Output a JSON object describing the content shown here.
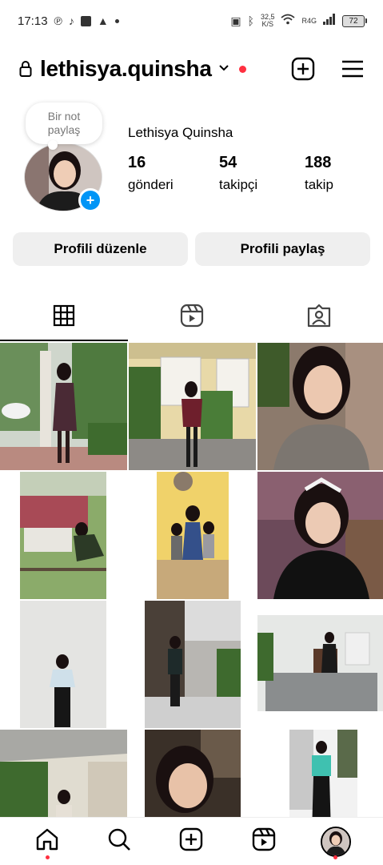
{
  "status_bar": {
    "time": "17:13",
    "speed_value": "32,5",
    "speed_unit": "K/S",
    "network": "R4G",
    "battery": "72"
  },
  "header": {
    "username": "lethisya.quinsha"
  },
  "profile": {
    "note_text": "Bir not paylaş",
    "full_name": "Lethisya Quinsha",
    "stats": {
      "posts_count": "16",
      "posts_label": "gönderi",
      "followers_count": "54",
      "followers_label": "takipçi",
      "following_count": "188",
      "following_label": "takip"
    }
  },
  "actions": {
    "edit_profile": "Profili düzenle",
    "share_profile": "Profili paylaş"
  },
  "tabs": [
    {
      "icon": "grid-icon",
      "active": true
    },
    {
      "icon": "reels-icon",
      "active": false
    },
    {
      "icon": "tagged-icon",
      "active": false
    }
  ],
  "bottom_nav": [
    {
      "icon": "home-icon",
      "notification_dot": true
    },
    {
      "icon": "search-icon",
      "notification_dot": false
    },
    {
      "icon": "create-icon",
      "notification_dot": false
    },
    {
      "icon": "reels-icon",
      "notification_dot": false
    },
    {
      "icon": "profile-avatar",
      "notification_dot": true
    }
  ],
  "colors": {
    "accent_blue": "#0095f6",
    "notification_red": "#ff3040",
    "button_gray": "#efefef"
  }
}
